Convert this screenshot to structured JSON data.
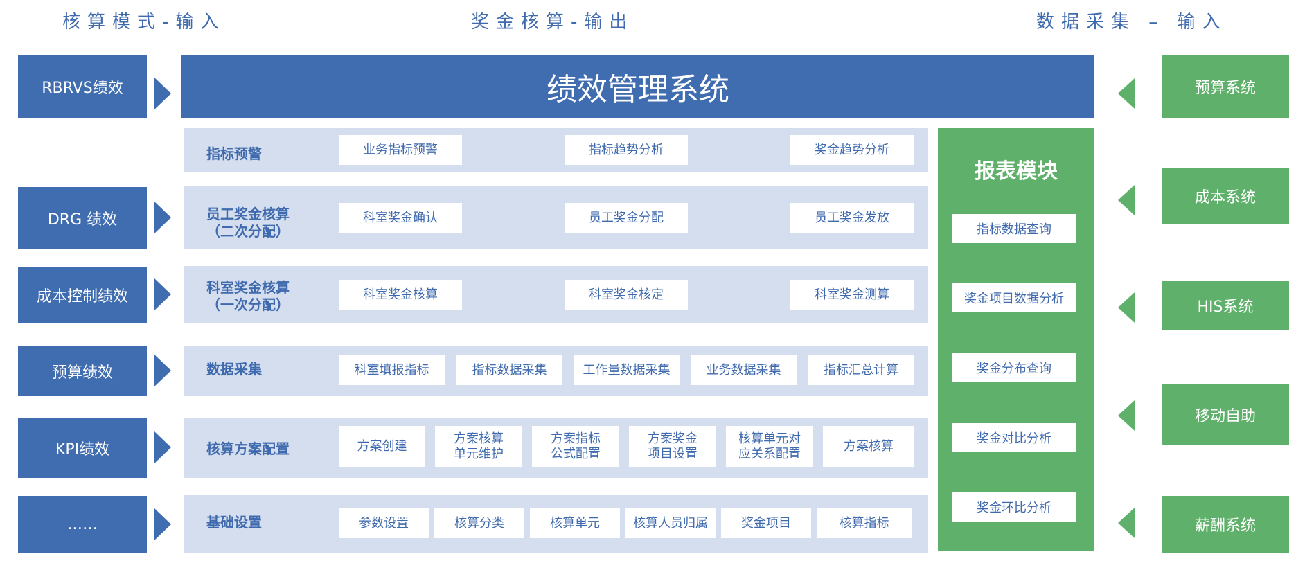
{
  "headers": {
    "left": "核算模式-输入",
    "middle": "奖金核算-输出",
    "right": "数据采集 – 输入"
  },
  "title": "绩效管理系统",
  "left_modes": [
    "RBRVS绩效",
    "DRG 绩效",
    "成本控制绩效",
    "预算绩效",
    "KPI绩效",
    "……"
  ],
  "right_sources": [
    "预算系统",
    "成本系统",
    "HIS系统",
    "移动自助",
    "薪酬系统"
  ],
  "rows": [
    {
      "label": "指标预警",
      "items": [
        "业务指标预警",
        "指标趋势分析",
        "奖金趋势分析"
      ]
    },
    {
      "label_line1": "员工奖金核算",
      "label_line2": "（二次分配）",
      "items": [
        "科室奖金确认",
        "员工奖金分配",
        "员工奖金发放"
      ]
    },
    {
      "label_line1": "科室奖金核算",
      "label_line2": "（一次分配）",
      "items": [
        "科室奖金核算",
        "科室奖金核定",
        "科室奖金测算"
      ]
    },
    {
      "label": "数据采集",
      "items": [
        "科室填报指标",
        "指标数据采集",
        "工作量数据采集",
        "业务数据采集",
        "指标汇总计算"
      ]
    },
    {
      "label": "核算方案配置",
      "items": [
        {
          "l1": "方案创建"
        },
        {
          "l1": "方案核算",
          "l2": "单元维护"
        },
        {
          "l1": "方案指标",
          "l2": "公式配置"
        },
        {
          "l1": "方案奖金",
          "l2": "项目设置"
        },
        {
          "l1": "核算单元对",
          "l2": "应关系配置"
        },
        {
          "l1": "方案核算"
        }
      ]
    },
    {
      "label": "基础设置",
      "items": [
        "参数设置",
        "核算分类",
        "核算单元",
        "核算人员归属",
        "奖金项目",
        "核算指标"
      ]
    }
  ],
  "report": {
    "title": "报表模块",
    "items": [
      "指标数据查询",
      "奖金项目数据分析",
      "奖金分布查询",
      "奖金对比分析",
      "奖金环比分析"
    ]
  },
  "colors": {
    "blue": "#3f6db0",
    "green": "#5fb06b",
    "band": "#d5deef",
    "text_blue": "#3f6aad"
  }
}
